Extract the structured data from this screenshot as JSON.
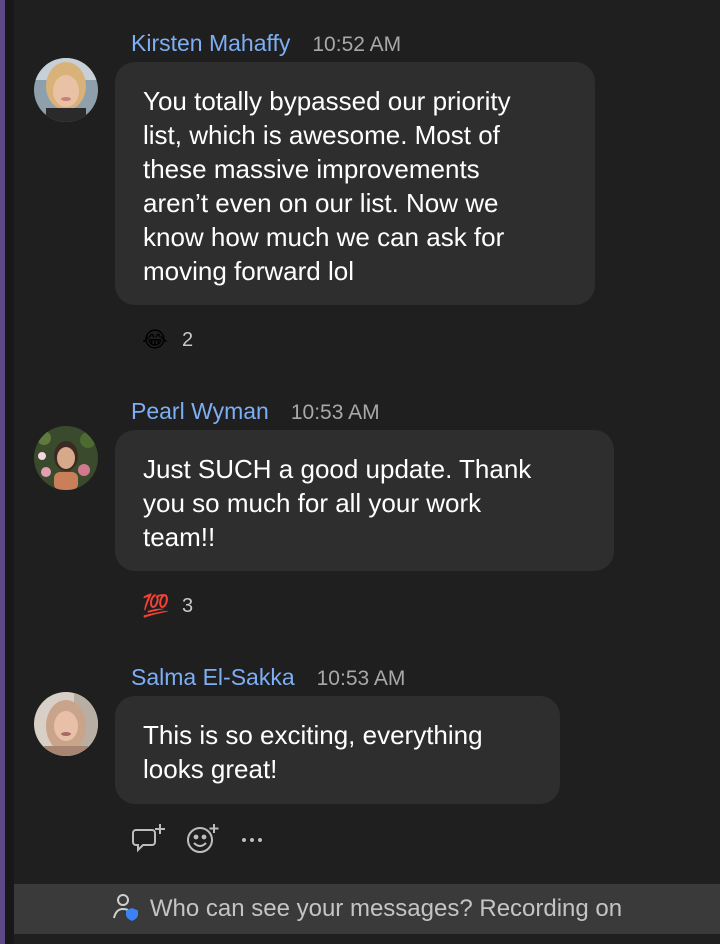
{
  "messages": [
    {
      "sender": "Kirsten Mahaffy",
      "time": "10:52 AM",
      "text": "You totally bypassed our priority\nlist, which is awesome. Most of\nthese massive improvements\naren’t even on our list. Now we\nknow how much we can ask for\nmoving forward lol",
      "reaction": {
        "emoji": "😂",
        "count": "2"
      }
    },
    {
      "sender": "Pearl Wyman",
      "time": "10:53 AM",
      "text": "Just SUCH a good update.  Thank\nyou so much for all your work\nteam!!",
      "reaction": {
        "emoji": "💯",
        "count": "3"
      }
    },
    {
      "sender": "Salma El-Sakka",
      "time": "10:53 AM",
      "text": "This is so exciting, everything\nlooks great!"
    }
  ],
  "hover_actions": [
    "reply-in-thread-icon",
    "add-reaction-icon",
    "more-actions-icon"
  ],
  "footer": {
    "notice": "Who can see your messages? Recording on"
  },
  "colors": {
    "name": "#7eaef3",
    "bubble": "#2e2e2e",
    "background": "#1f1f1f",
    "accent_bar": "#5b4a86"
  }
}
